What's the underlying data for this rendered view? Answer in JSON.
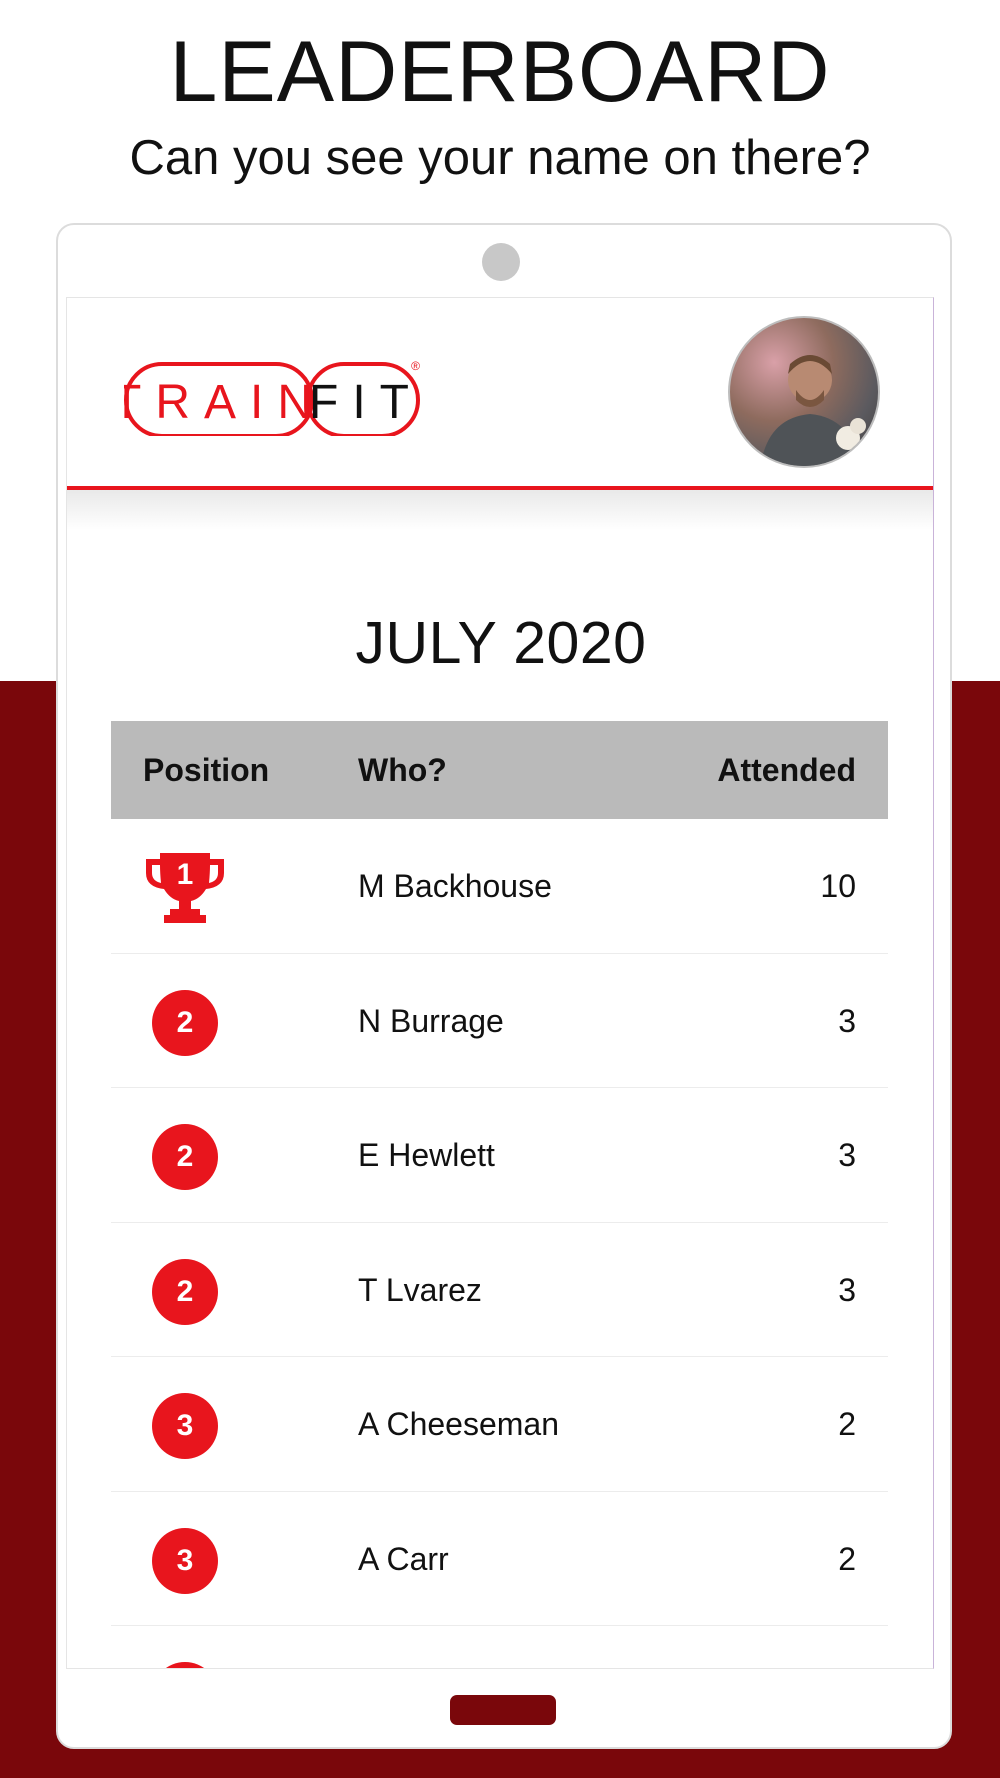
{
  "promo": {
    "title": "LEADERBOARD",
    "subtitle": "Can you see your name on there?"
  },
  "app": {
    "logo_text_left": "TRAIN",
    "logo_text_right": "FIT",
    "logo_mark": "®",
    "avatar_icon": "user-avatar"
  },
  "leaderboard": {
    "month": "JULY 2020",
    "columns": {
      "position": "Position",
      "who": "Who?",
      "attended": "Attended"
    },
    "rows": [
      {
        "position": "1",
        "who": "M Backhouse",
        "attended": "10",
        "icon": "trophy-icon"
      },
      {
        "position": "2",
        "who": "N Burrage",
        "attended": "3"
      },
      {
        "position": "2",
        "who": "E Hewlett",
        "attended": "3"
      },
      {
        "position": "2",
        "who": "T Lvarez",
        "attended": "3"
      },
      {
        "position": "3",
        "who": "A Cheeseman",
        "attended": "2"
      },
      {
        "position": "3",
        "who": "A Carr",
        "attended": "2"
      }
    ]
  },
  "colors": {
    "accent": "#e8151d",
    "dark_red": "#7a070b",
    "header_gray": "#bababa"
  }
}
